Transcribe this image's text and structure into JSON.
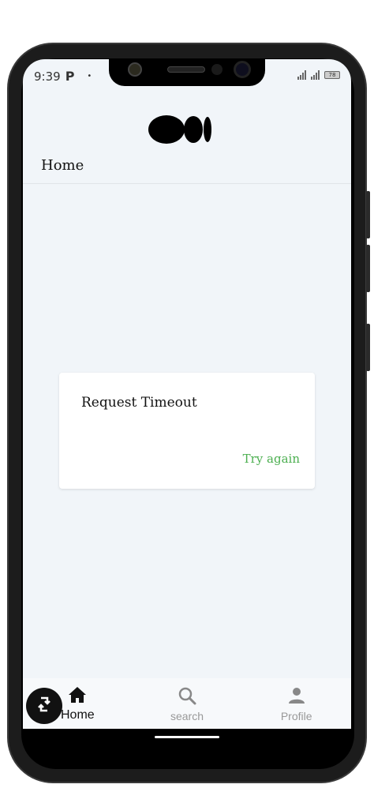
{
  "status_bar": {
    "time": "9:39",
    "app_icon_letter": "P",
    "dot": "•",
    "battery": "78"
  },
  "header": {
    "title": "Home"
  },
  "dialog": {
    "message": "Request Timeout",
    "action_label": "Try again",
    "action_color": "#4caf50"
  },
  "bottom_nav": {
    "items": [
      {
        "label": "Home",
        "icon": "home-icon",
        "active": true
      },
      {
        "label": "search",
        "icon": "search-icon",
        "active": false
      },
      {
        "label": "Profile",
        "icon": "profile-icon",
        "active": false
      }
    ]
  },
  "fab": {
    "icon": "rotate-icon"
  }
}
